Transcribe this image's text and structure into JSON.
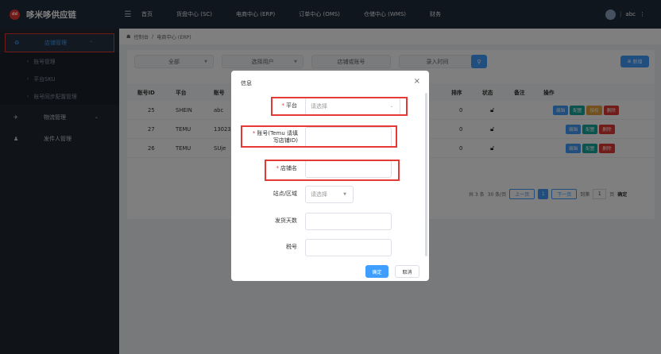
{
  "app": {
    "logo_badge": "dd",
    "title": "哆米哆供应链"
  },
  "topnav": [
    "首页",
    "货盘中心 (SC)",
    "电商中心 (ERP)",
    "订单中心 (OMS)",
    "仓储中心 (WMS)",
    "财务"
  ],
  "user": {
    "name": "abc",
    "more": "⋮"
  },
  "sidebar": {
    "store_mgmt": "店铺管理",
    "sub": [
      "账号管理",
      "平台SKU",
      "账号同步配置管理"
    ],
    "logistics": "物流管理",
    "sender": "发件人管理"
  },
  "breadcrumb": {
    "home": "控制台",
    "sep": "/",
    "current": "电商中心 (ERP)"
  },
  "filters": {
    "all": "全部",
    "user": "选择用户",
    "store": "店铺或账号",
    "time": "录入时间"
  },
  "buttons": {
    "new": "新增",
    "search_icon": "⚲"
  },
  "table": {
    "headers": {
      "id": "账号ID",
      "platform": "平台",
      "account": "账号",
      "sort": "排序",
      "status": "状态",
      "remark": "备注",
      "ops": "操作"
    },
    "rows": [
      {
        "id": "25",
        "platform": "SHEIN",
        "account": "abc",
        "sort": "0"
      },
      {
        "id": "27",
        "platform": "TEMU",
        "account": "13023",
        "sort": "0"
      },
      {
        "id": "26",
        "platform": "TEMU",
        "account": "SUje",
        "sort": "0"
      }
    ],
    "ops": {
      "edit": "编辑",
      "config": "配置",
      "auth": "授权",
      "delete": "删除"
    }
  },
  "pager": {
    "total": "共 3 条",
    "per_page": "30 条/页",
    "prev": "上一页",
    "page": "1",
    "next": "下一页",
    "goto": "到第",
    "goto_value": "1",
    "page_unit": "页",
    "confirm": "确定"
  },
  "modal": {
    "title": "信息",
    "close": "×",
    "platform_label": "平台",
    "platform_placeholder": "请选择",
    "account_label": "账号(Temu 请填写店铺ID)",
    "store_label": "店铺名",
    "site_label": "站点/区域",
    "site_placeholder": "请选择",
    "days_label": "发货天数",
    "tax_label": "税号",
    "ok": "确定",
    "cancel": "取消"
  },
  "colors": {
    "primary": "#409eff",
    "danger": "#e53935",
    "topbar": "#1f2d3d",
    "sidebar": "#20272f"
  }
}
